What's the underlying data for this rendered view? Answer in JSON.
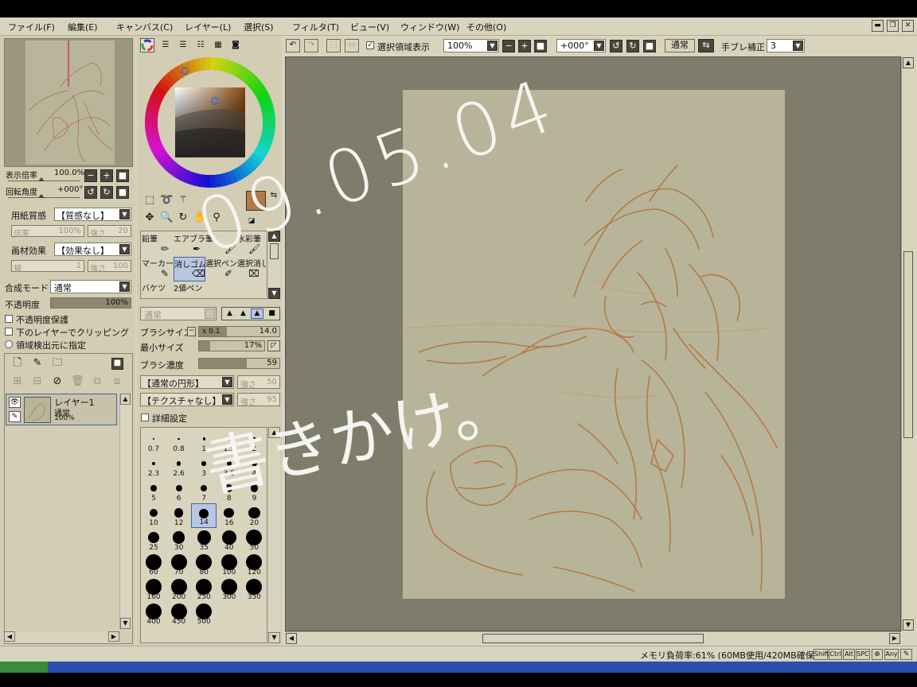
{
  "menu": [
    "ファイル(F)",
    "編集(E)",
    "キャンバス(C)",
    "レイヤー(L)",
    "選択(S)",
    "フィルタ(T)",
    "ビュー(V)",
    "ウィンドウ(W)",
    "その他(O)"
  ],
  "nav": {
    "zoom_label": "表示倍率",
    "zoom_value": "100.0%",
    "rotate_label": "回転角度",
    "rotate_value": "+000°"
  },
  "paper": {
    "texture_label": "用紙質感",
    "texture_value": "【質感なし】",
    "texture_scale_label": "倍率",
    "texture_scale_value": "100%",
    "texture_strength_label": "強さ",
    "texture_strength_value": "20",
    "effect_label": "画材効果",
    "effect_value": "【効果なし】",
    "effect_width_label": "幅",
    "effect_width_value": "1",
    "effect_strength_label": "強さ",
    "effect_strength_value": "100"
  },
  "layer_props": {
    "blend_label": "合成モード",
    "blend_value": "通常",
    "opacity_label": "不透明度",
    "opacity_value": "100%",
    "opacity_fraction": 1.0,
    "options": [
      "不透明度保護",
      "下のレイヤーでクリッピング",
      "領域検出元に指定"
    ]
  },
  "layer": {
    "name": "レイヤー1",
    "mode": "通常",
    "opacity": "100%"
  },
  "color": {
    "main_color": "#b07b48",
    "accent": "#8a5a2c"
  },
  "tools": [
    {
      "label": "鉛筆",
      "id": "pencil"
    },
    {
      "label": "エアブラシ",
      "id": "airbrush"
    },
    {
      "label": "筆",
      "id": "brush"
    },
    {
      "label": "水彩筆",
      "id": "watercolor"
    },
    {
      "label": "マーカー",
      "id": "marker"
    },
    {
      "label": "消しゴム",
      "id": "eraser"
    },
    {
      "label": "選択ペン",
      "id": "select-pen"
    },
    {
      "label": "選択消し",
      "id": "select-erase"
    },
    {
      "label": "バケツ",
      "id": "bucket"
    },
    {
      "label": "2値ペン",
      "id": "binary-pen"
    }
  ],
  "brush": {
    "mode_value": "通常",
    "size_label": "ブラシサイズ",
    "size_mult": "x 0.1",
    "size_value": "14.0",
    "size_fraction": 0.35,
    "min_size_label": "最小サイズ",
    "min_size_value": "17%",
    "min_size_fraction": 0.17,
    "density_label": "ブラシ濃度",
    "density_value": "59",
    "density_fraction": 0.59,
    "shape_value": "【通常の円形】",
    "shape_strength_label": "強さ",
    "shape_strength_value": "50",
    "texture_value": "【テクスチャなし】",
    "texture_strength_label": "強さ",
    "texture_strength_value": "95",
    "detail_label": "詳細設定",
    "sizes": [
      "0.7",
      "0.8",
      "1",
      "1.5",
      "2",
      "2.3",
      "2.6",
      "3",
      "3.5",
      "4",
      "5",
      "6",
      "7",
      "8",
      "9",
      "10",
      "12",
      "14",
      "16",
      "20",
      "25",
      "30",
      "35",
      "40",
      "50",
      "60",
      "70",
      "80",
      "100",
      "120",
      "160",
      "200",
      "250",
      "300",
      "350",
      "400",
      "450",
      "500"
    ],
    "selected_size": "14"
  },
  "toolbar": {
    "show_selection_label": "選択領域表示",
    "zoom_value": "100%",
    "angle_value": "+000°",
    "mode_label": "通常",
    "stabilizer_label": "手ブレ補正",
    "stabilizer_value": "3"
  },
  "canvas_text": {
    "date": "09.05.04",
    "caption": "書きかけ。"
  },
  "status": {
    "memory": "メモリ負荷率:61% (60MB使用/420MB確保)",
    "keys": [
      "Shift",
      "Ctrl",
      "Alt",
      "SPC",
      "Any"
    ]
  }
}
